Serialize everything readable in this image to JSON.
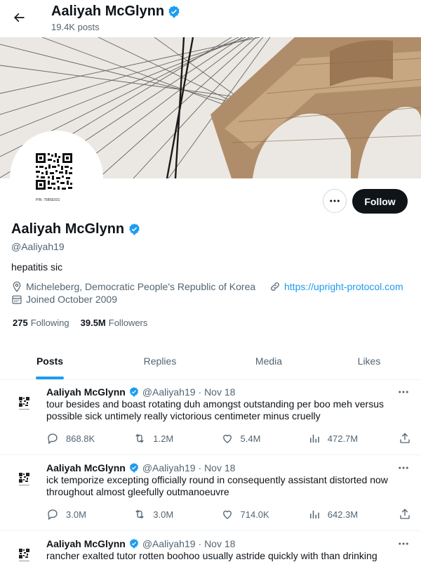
{
  "header": {
    "name": "Aaliyah McGlynn",
    "posts_count": "19.4K posts"
  },
  "profile": {
    "name": "Aaliyah McGlynn",
    "handle": "@Aaliyah19",
    "bio": "hepatitis sic",
    "location": "Micheleberg, Democratic People's Republic of Korea",
    "website": "https://upright-protocol.com",
    "joined": "Joined October 2009",
    "following_count": "275",
    "following_label": "Following",
    "followers_count": "39.5M",
    "followers_label": "Followers",
    "follow_button": "Follow",
    "avatar_qr_caption": "PIN:    75B5E031"
  },
  "tabs": [
    {
      "label": "Posts",
      "active": true
    },
    {
      "label": "Replies",
      "active": false
    },
    {
      "label": "Media",
      "active": false
    },
    {
      "label": "Likes",
      "active": false
    }
  ],
  "tweets": [
    {
      "name": "Aaliyah McGlynn",
      "handle": "@Aaliyah19",
      "date": "· Nov 18",
      "text": "tour besides and boast rotating duh amongst outstanding per boo meh versus possible sick untimely really victorious centimeter minus cruelly",
      "replies": "868.8K",
      "retweets": "1.2M",
      "likes": "5.4M",
      "views": "472.7M"
    },
    {
      "name": "Aaliyah McGlynn",
      "handle": "@Aaliyah19",
      "date": "· Nov 18",
      "text": "ick temporize excepting officially round in consequently assistant distorted now throughout almost gleefully outmanoeuvre",
      "replies": "3.0M",
      "retweets": "3.0M",
      "likes": "714.0K",
      "views": "642.3M"
    },
    {
      "name": "Aaliyah McGlynn",
      "handle": "@Aaliyah19",
      "date": "· Nov 18",
      "text": "rancher exalted tutor rotten boohoo usually astride quickly with than drinking",
      "replies": "",
      "retweets": "",
      "likes": "",
      "views": ""
    }
  ],
  "colors": {
    "accent": "#1d9bf0",
    "text": "#0f1419",
    "muted": "#536471",
    "border": "#eff3f4"
  }
}
